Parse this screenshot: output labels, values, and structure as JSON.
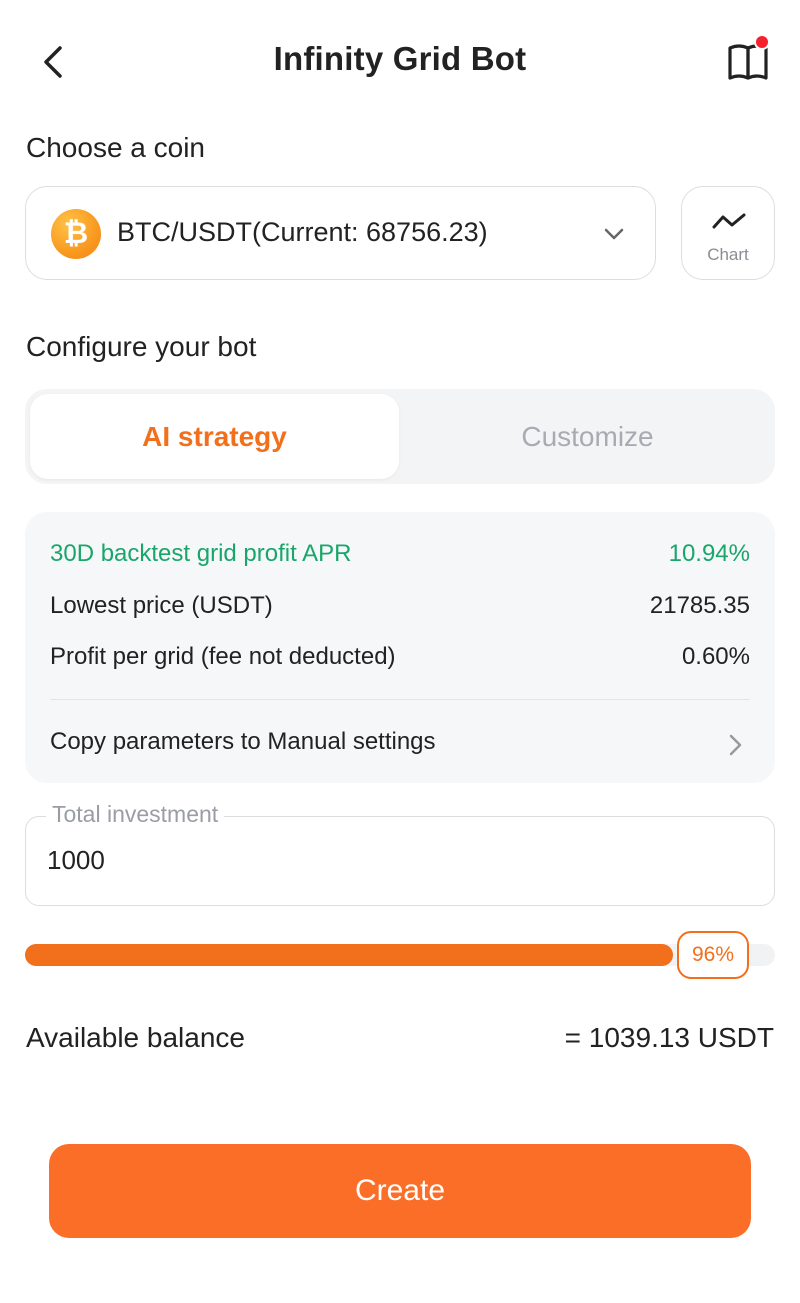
{
  "header": {
    "title": "Infinity Grid Bot"
  },
  "coin_section": {
    "label": "Choose a coin",
    "coin_icon_glyph": "₿",
    "selected_pair": "BTC/USDT(Current: 68756.23)",
    "chart_button_label": "Chart"
  },
  "config_section": {
    "label": "Configure your bot",
    "tabs": [
      {
        "label": "AI strategy",
        "active": true
      },
      {
        "label": "Customize",
        "active": false
      }
    ]
  },
  "strategy_info": {
    "rows": [
      {
        "label": "30D backtest grid profit APR",
        "value": "10.94%"
      },
      {
        "label": "Lowest price (USDT)",
        "value": "21785.35"
      },
      {
        "label": "Profit per grid (fee not deducted)",
        "value": "0.60%"
      }
    ],
    "copy_link_label": "Copy parameters to Manual settings"
  },
  "investment": {
    "label": "Total investment",
    "value": "1000"
  },
  "slider": {
    "percent": 96,
    "label": "96%"
  },
  "balance": {
    "label": "Available balance",
    "value": "= 1039.13 USDT"
  },
  "create_button_label": "Create",
  "colors": {
    "accent": "#f26f1c",
    "button": "#fb6e27",
    "positive": "#1aa66a",
    "notification_dot": "#f5222d"
  }
}
